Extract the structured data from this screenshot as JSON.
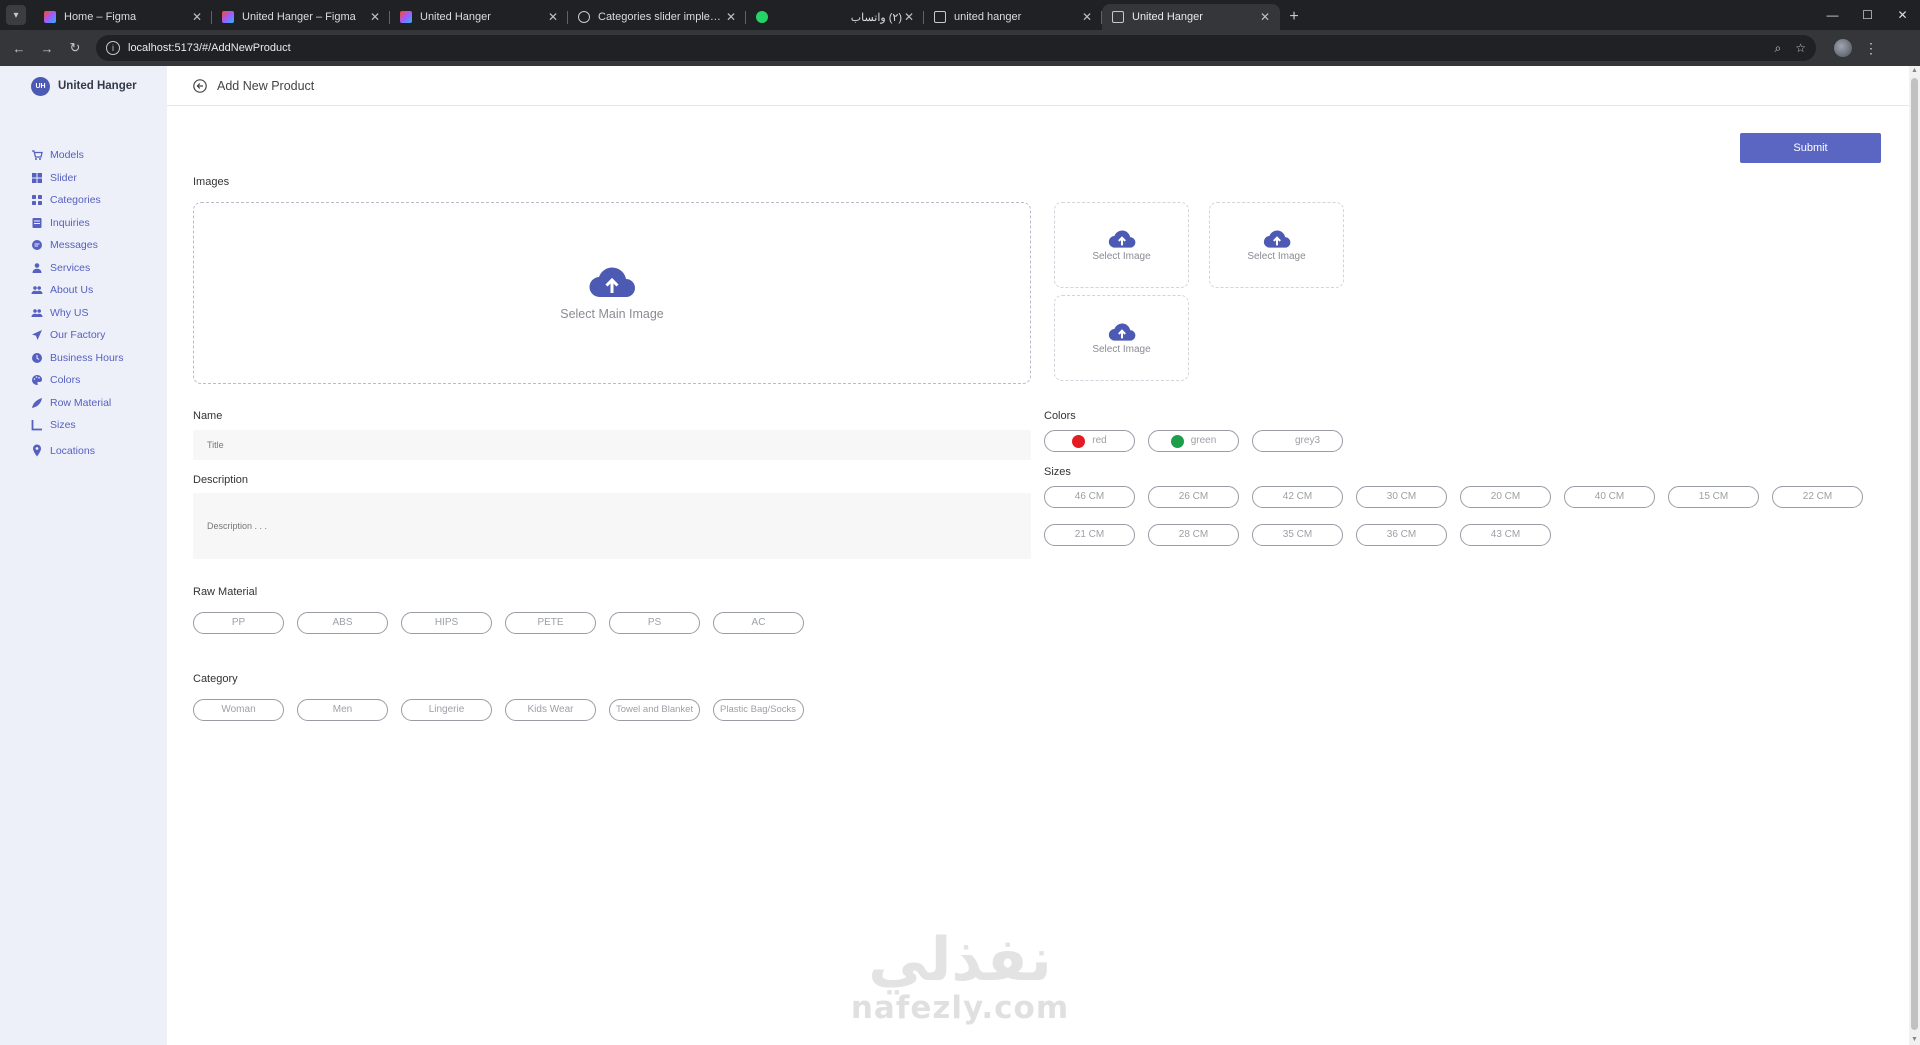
{
  "browser": {
    "tabs": [
      {
        "title": "Home – Figma",
        "icon": "figma-icon",
        "active": false
      },
      {
        "title": "United Hanger – Figma",
        "icon": "figma-icon",
        "active": false
      },
      {
        "title": "United Hanger",
        "icon": "figma-icon",
        "active": false
      },
      {
        "title": "Categories slider implementatio",
        "icon": "globe-icon",
        "active": false
      },
      {
        "title": "(٢) واتساب",
        "icon": "whatsapp-icon",
        "active": false
      },
      {
        "title": "united hanger",
        "icon": "page-icon",
        "active": false
      },
      {
        "title": "United Hanger",
        "icon": "page-icon",
        "active": true
      }
    ],
    "url": "localhost:5173/#/AddNewProduct"
  },
  "sidebar": {
    "brand_initials": "UH",
    "brand_name": "United Hanger",
    "items": [
      {
        "label": "Models",
        "icon": "cart-icon"
      },
      {
        "label": "Slider",
        "icon": "slider-icon"
      },
      {
        "label": "Categories",
        "icon": "grid-icon"
      },
      {
        "label": "Inquiries",
        "icon": "document-icon"
      },
      {
        "label": "Messages",
        "icon": "message-icon"
      },
      {
        "label": "Services",
        "icon": "person-icon"
      },
      {
        "label": "About Us",
        "icon": "group-icon"
      },
      {
        "label": "Why US",
        "icon": "group-icon"
      },
      {
        "label": "Our Factory",
        "icon": "send-icon"
      },
      {
        "label": "Business Hours",
        "icon": "clock-icon"
      },
      {
        "label": "Colors",
        "icon": "palette-icon"
      },
      {
        "label": "Row Material",
        "icon": "material-icon"
      },
      {
        "label": "Sizes",
        "icon": "ruler-icon"
      },
      {
        "label": "Locations",
        "icon": "location-icon"
      }
    ]
  },
  "header": {
    "title": "Add New Product"
  },
  "form": {
    "submit_label": "Submit",
    "images_label": "Images",
    "main_image_label": "Select Main Image",
    "image_slots": [
      "Select Image",
      "Select Image",
      "Select Image"
    ],
    "name_label": "Name",
    "name_placeholder": "Title",
    "description_label": "Description",
    "description_placeholder": "Description . . .",
    "raw_material_label": "Raw Material",
    "raw_materials": [
      "PP",
      "ABS",
      "HIPS",
      "PETE",
      "PS",
      "AC"
    ],
    "category_label": "Category",
    "categories": [
      "Woman",
      "Men",
      "Lingerie",
      "Kids Wear",
      "Towel and Blanket",
      "Plastic Bag/Socks"
    ],
    "colors_label": "Colors",
    "colors": [
      {
        "name": "red",
        "hex": "#e41b23"
      },
      {
        "name": "green",
        "hex": "#1e9e4a"
      },
      {
        "name": "grey3",
        "hex": ""
      }
    ],
    "sizes_label": "Sizes",
    "sizes": [
      "46 CM",
      "26 CM",
      "42 CM",
      "30 CM",
      "20 CM",
      "40 CM",
      "15 CM",
      "22 CM",
      "21 CM",
      "28 CM",
      "35 CM",
      "36 CM",
      "43 CM"
    ]
  },
  "watermark": {
    "arabic": "نفذلي",
    "latin": "nafezly.com"
  },
  "theme": {
    "accent": "#5b66c2",
    "sidebar_bg": "#eef0f9",
    "sidebar_text": "#5560c0"
  }
}
